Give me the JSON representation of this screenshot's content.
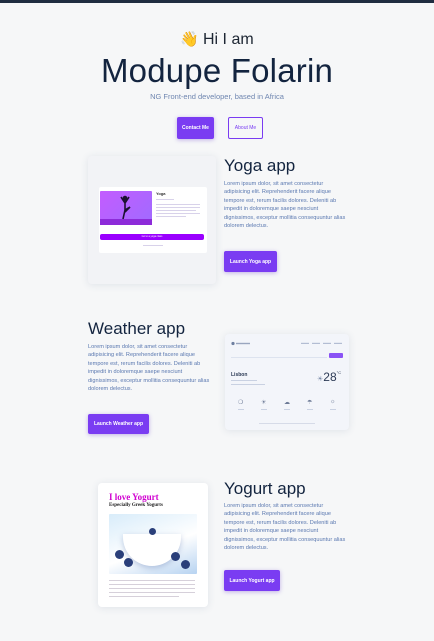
{
  "hero": {
    "wave_emoji": "👋",
    "greeting": "Hi I am",
    "name": "Modupe Folarin",
    "subtitle": "NG Front-end developer, based in Africa",
    "contact_button": "Contact Me",
    "about_button": "About Me"
  },
  "projects": [
    {
      "title": "Yoga app",
      "description": "Lorem ipsum dolor, sit amet consectetur adipisicing elit. Reprehenderit facere alique tempore est, rerum facilis dolores. Deleniti ab impedit in doloremque saepe nesciunt dignissimos, exceptur mollitia consequuntur alias dolorem delectus.",
      "button": "Launch Yoga app",
      "preview": {
        "heading": "Yoga",
        "bar_label": "Go to a yoga class"
      }
    },
    {
      "title": "Weather app",
      "description": "Lorem ipsum dolor, sit amet consectetur adipisicing elit. Reprehenderit facere alique tempore est, rerum facilis dolores. Deleniti ab impedit in doloremque saepe nesciunt dignissimos, exceptur mollitia consequuntur alias dolorem delectus.",
      "button": "Launch Weather app",
      "preview": {
        "city": "Lisbon",
        "temperature": "28",
        "unit": "°C"
      }
    },
    {
      "title": "Yogurt app",
      "description": "Lorem ipsum dolor, sit amet consectetur adipisicing elit. Reprehenderit facere alique tempore est, rerum facilis dolores. Deleniti ab impedit in doloremque saepe nesciunt dignissimos, exceptur mollitia consequuntur alias dolorem delectus.",
      "button": "Launch Yogurt app",
      "preview": {
        "heading": "I love Yogurt",
        "subheading": "Especially Greek Yogurts"
      }
    }
  ],
  "colors": {
    "accent": "#7a3cf2",
    "title": "#13243f",
    "body_text": "#5a78b0"
  }
}
